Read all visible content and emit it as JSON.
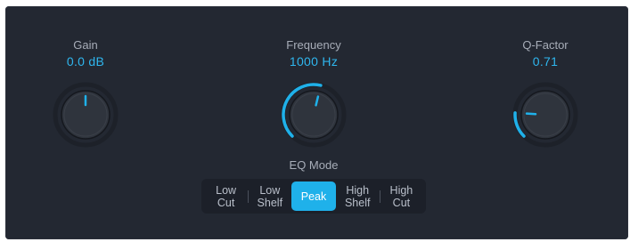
{
  "gain": {
    "label": "Gain",
    "value": "0.0 dB",
    "level": 0.5
  },
  "frequency": {
    "label": "Frequency",
    "value": "1000 Hz",
    "level": 0.55
  },
  "qfactor": {
    "label": "Q-Factor",
    "value": "0.71",
    "level": 0.18
  },
  "eq_mode": {
    "label": "EQ Mode",
    "options": [
      "Low\nCut",
      "Low\nShelf",
      "Peak",
      "High\nShelf",
      "High\nCut"
    ],
    "selected": "Peak"
  },
  "colors": {
    "accent": "#1fb1ea",
    "panel": "#232832",
    "knob": "#2f343d",
    "label": "#a7adb8"
  }
}
